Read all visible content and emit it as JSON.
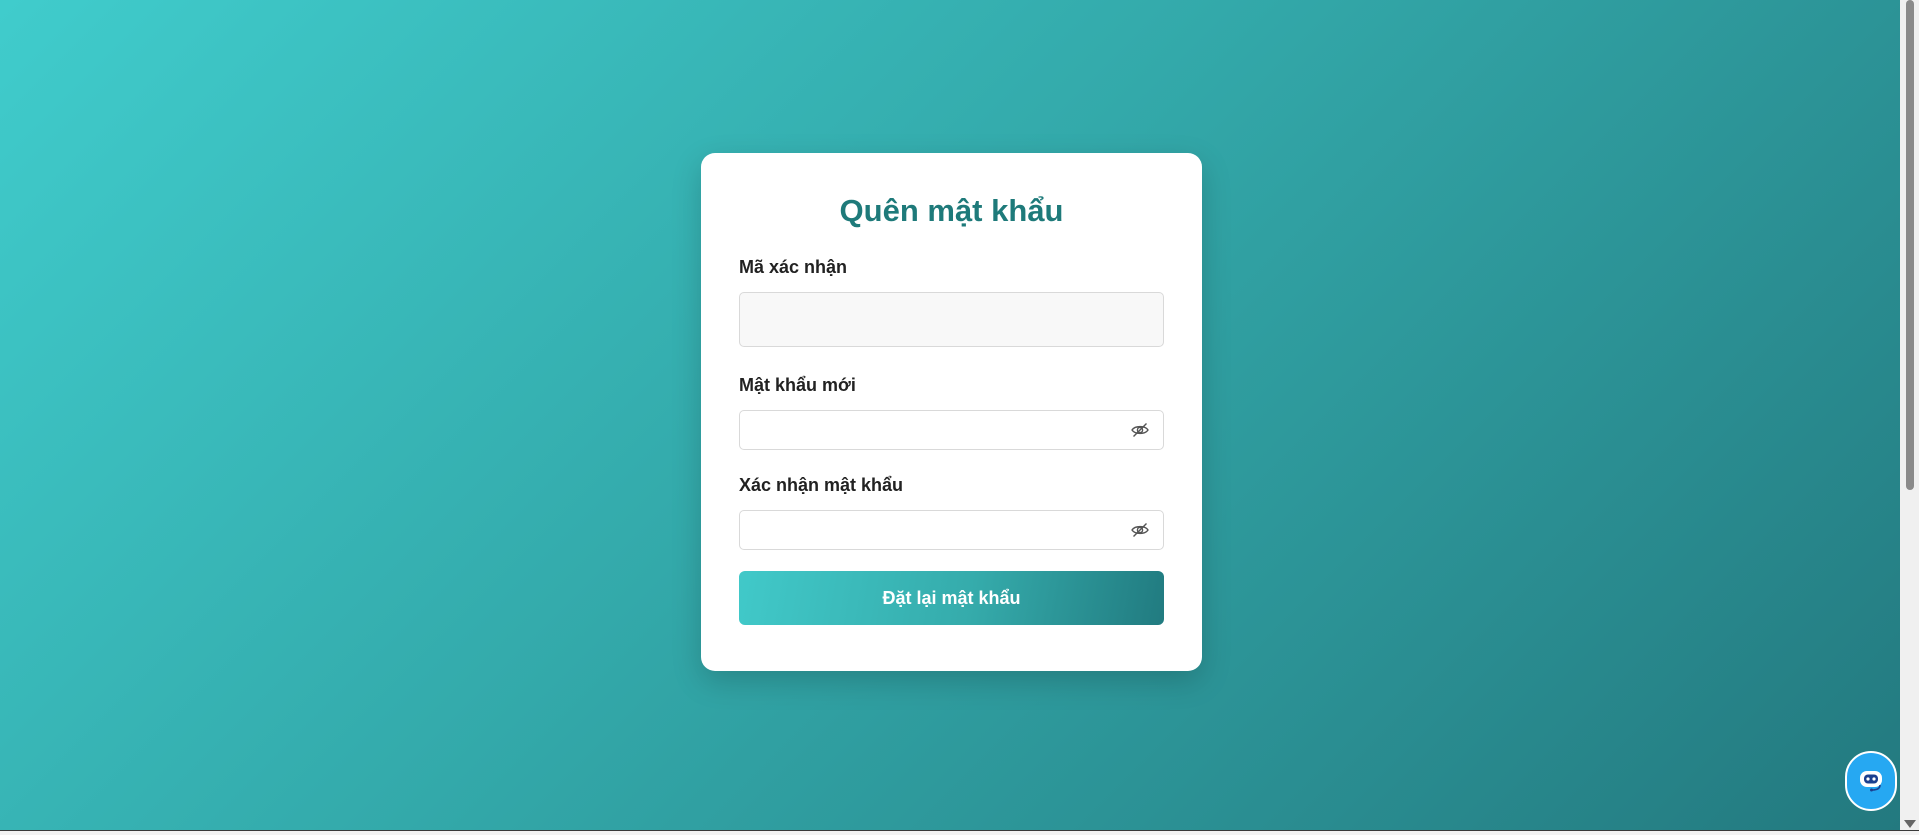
{
  "page": {
    "title": "Quên mật khẩu"
  },
  "form": {
    "code_label": "Mã xác nhận",
    "code_value": "",
    "new_password_label": "Mật khẩu mới",
    "new_password_value": "",
    "confirm_password_label": "Xác nhận mật khẩu",
    "confirm_password_value": "",
    "submit_label": "Đặt lại mật khẩu"
  },
  "icons": {
    "password_toggle": "eye-off-icon",
    "chat": "chatbot-icon"
  },
  "colors": {
    "title": "#1e7a7a",
    "gradient_start": "#40cccc",
    "gradient_end": "#23797f",
    "chat_button": "#26a8f2"
  }
}
